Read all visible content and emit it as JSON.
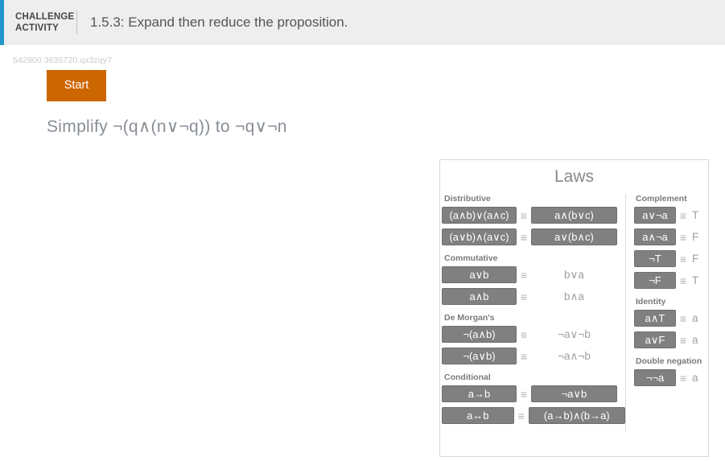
{
  "header": {
    "label_line1": "CHALLENGE",
    "label_line2": "ACTIVITY",
    "title": "1.5.3: Expand then reduce the proposition."
  },
  "activity": {
    "id": "542900.3635720.qx3zqy7",
    "start_label": "Start",
    "problem": "Simplify ¬(q∧(n∨¬q)) to ¬q∨¬n"
  },
  "colors": {
    "accent_blue": "#2196cc",
    "start_orange": "#cc6600",
    "button_gray": "#808080",
    "header_gray": "#eeeeee"
  },
  "laws": {
    "title": "Laws",
    "equiv_symbol": "≡",
    "left_groups": [
      {
        "title": "Distributive",
        "rows": [
          {
            "left": "(a∧b)∨(a∧c)",
            "right": "a∧(b∨c)",
            "right_is_button": true
          },
          {
            "left": "(a∨b)∧(a∨c)",
            "right": "a∨(b∧c)",
            "right_is_button": true
          }
        ]
      },
      {
        "title": "Commutative",
        "rows": [
          {
            "left": "a∨b",
            "right": "b∨a",
            "right_is_button": false
          },
          {
            "left": "a∧b",
            "right": "b∧a",
            "right_is_button": false
          }
        ]
      },
      {
        "title": "De Morgan's",
        "rows": [
          {
            "left": "¬(a∧b)",
            "right": "¬a∨¬b",
            "right_is_button": false
          },
          {
            "left": "¬(a∨b)",
            "right": "¬a∧¬b",
            "right_is_button": false
          }
        ]
      },
      {
        "title": "Conditional",
        "rows": [
          {
            "left": "a→b",
            "right": "¬a∨b",
            "right_is_button": true
          },
          {
            "left": "a↔b",
            "right": "(a→b)∧(b→a)",
            "right_is_button": true
          }
        ]
      }
    ],
    "right_groups": [
      {
        "title": "Complement",
        "rows": [
          {
            "left": "a∨¬a",
            "right": "T"
          },
          {
            "left": "a∧¬a",
            "right": "F"
          },
          {
            "left": "¬T",
            "right": "F"
          },
          {
            "left": "¬F",
            "right": "T"
          }
        ]
      },
      {
        "title": "Identity",
        "rows": [
          {
            "left": "a∧T",
            "right": "a"
          },
          {
            "left": "a∨F",
            "right": "a"
          }
        ]
      },
      {
        "title": "Double negation",
        "rows": [
          {
            "left": "¬¬a",
            "right": "a"
          }
        ]
      }
    ]
  }
}
